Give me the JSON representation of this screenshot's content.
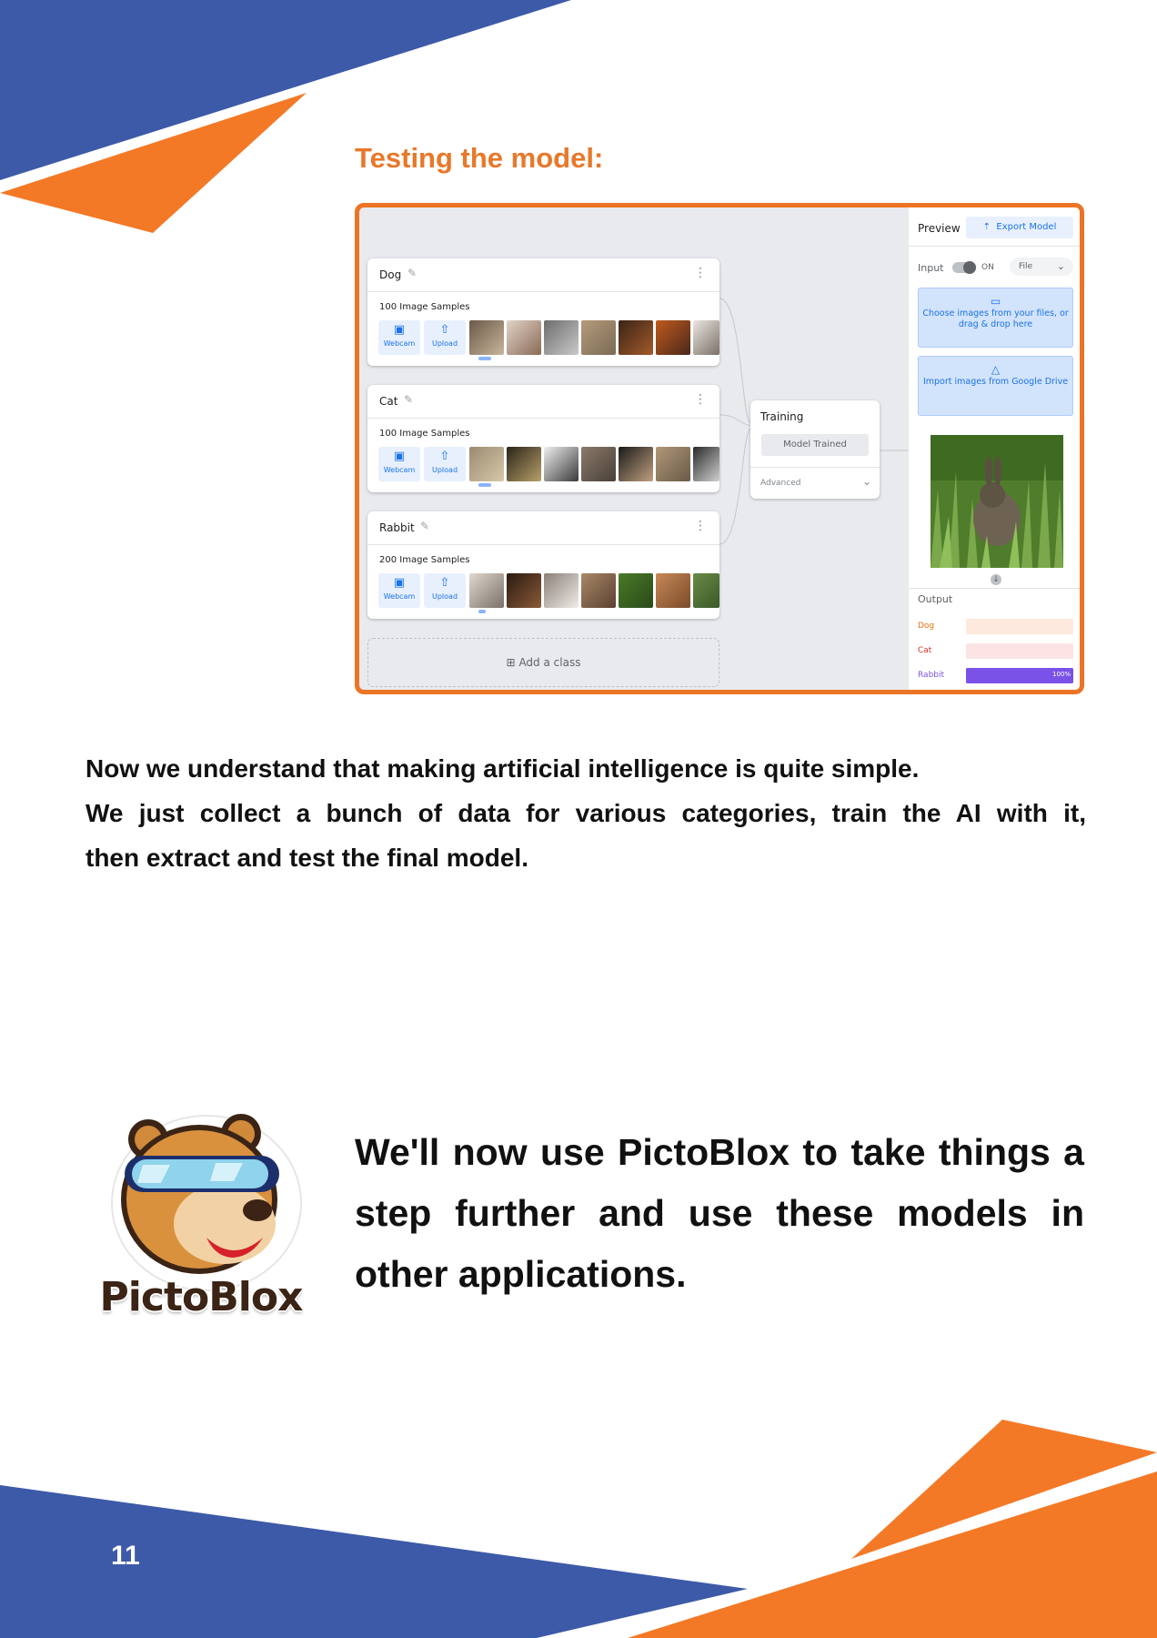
{
  "heading": "Testing the model:",
  "screenshot": {
    "classes": [
      {
        "name": "Dog",
        "samples": "100 Image Samples"
      },
      {
        "name": "Cat",
        "samples": "100 Image Samples"
      },
      {
        "name": "Rabbit",
        "samples": "200 Image Samples"
      }
    ],
    "webcam_label": "Webcam",
    "upload_label": "Upload",
    "add_class_label": "Add a class",
    "training": {
      "title": "Training",
      "button": "Model Trained",
      "advanced": "Advanced"
    },
    "preview": {
      "title": "Preview",
      "export_button": "Export Model",
      "input_label": "Input",
      "toggle_state": "ON",
      "input_source": "File",
      "choose_files": "Choose images from your files, or drag & drop here",
      "import_drive": "Import images from Google Drive",
      "output_title": "Output",
      "outputs": [
        {
          "label": "Dog",
          "value": 0,
          "color": "#e8710a",
          "bg": "#fde9dd"
        },
        {
          "label": "Cat",
          "value": 0,
          "color": "#d93025",
          "bg": "#fce4e4"
        },
        {
          "label": "Rabbit",
          "value": 1,
          "color": "#7b52e8",
          "bg": "#7b52e8",
          "percent_text": "100%"
        }
      ]
    }
  },
  "paragraph": [
    "Now we understand that making artificial intelligence is quite simple.",
    "We just collect a bunch of data for various categories, train the AI with it,",
    "then extract and test the final model."
  ],
  "logo_text": "PictoBlox",
  "big_paragraph": "We'll now use PictoBlox to take things a step further and use these models in other applications.",
  "page_number": "11",
  "colors": {
    "blue": "#3d5aa8",
    "orange": "#f47927",
    "heading_orange": "#e8782a"
  }
}
